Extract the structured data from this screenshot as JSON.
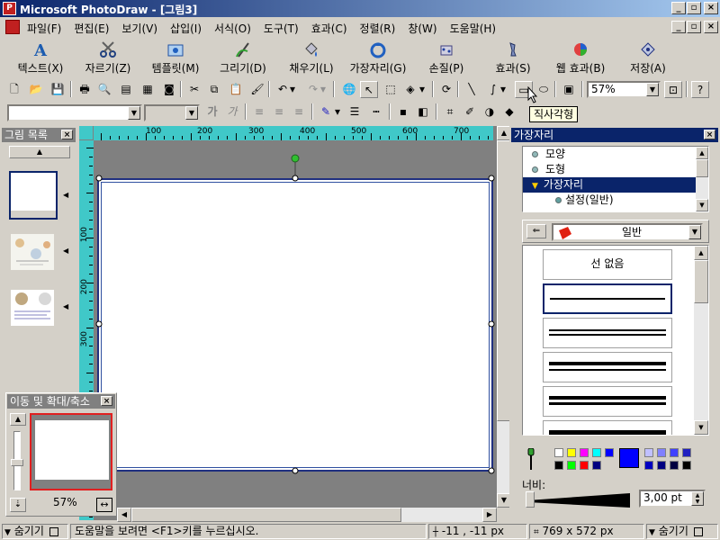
{
  "window": {
    "title": "Microsoft PhotoDraw - [그림3]"
  },
  "menu": [
    "파일(F)",
    "편집(E)",
    "보기(V)",
    "삽입(I)",
    "서식(O)",
    "도구(T)",
    "효과(C)",
    "정렬(R)",
    "창(W)",
    "도움말(H)"
  ],
  "big_toolbar": [
    {
      "label": "텍스트(X)",
      "icon": "text-icon"
    },
    {
      "label": "자르기(Z)",
      "icon": "scissors-icon"
    },
    {
      "label": "템플릿(M)",
      "icon": "template-icon"
    },
    {
      "label": "그리기(D)",
      "icon": "draw-icon"
    },
    {
      "label": "채우기(L)",
      "icon": "fill-icon"
    },
    {
      "label": "가장자리(G)",
      "icon": "edge-icon"
    },
    {
      "label": "손질(P)",
      "icon": "touchup-icon"
    },
    {
      "label": "효과(S)",
      "icon": "effects-icon"
    },
    {
      "label": "웹 효과(B)",
      "icon": "web-effects-icon"
    },
    {
      "label": "저장(A)",
      "icon": "save-icon"
    }
  ],
  "std_toolbar": {
    "zoom": "57%",
    "tooltip": "직사각형"
  },
  "format_toolbar": {
    "font": "",
    "size": "",
    "bold": "가",
    "italic": "가"
  },
  "picture_list": {
    "title": "그림 목록"
  },
  "pan_zoom": {
    "title": "이동 및 확대/축소",
    "zoom": "57%"
  },
  "ruler": {
    "h": [
      "100",
      "200",
      "300",
      "400",
      "500",
      "600",
      "700"
    ],
    "v": [
      "100",
      "200",
      "300"
    ]
  },
  "edge_panel": {
    "title": "가장자리",
    "tree": [
      {
        "label": "모양",
        "level": 0,
        "selected": false
      },
      {
        "label": "도형",
        "level": 0,
        "selected": false
      },
      {
        "label": "가장자리",
        "level": 0,
        "selected": true
      },
      {
        "label": "설정(일반)",
        "level": 1,
        "selected": false
      }
    ],
    "category": "일반",
    "styles": [
      {
        "label": "선 없음"
      }
    ],
    "width_label": "너비:",
    "width_value": "3,00 pt",
    "colors_top": [
      "#ffffff",
      "#ffff00",
      "#ff00ff",
      "#00ffff",
      "#0000ff"
    ],
    "colors_bottom": [
      "#000000",
      "#00ff00",
      "#ff0000",
      "#000080"
    ],
    "selected_color": "#0000ff",
    "colors_right_top": [
      "#c0c0ff",
      "#8080ff",
      "#4040ff",
      "#2020c0"
    ],
    "colors_right_bottom": [
      "#0000c0",
      "#000080",
      "#000040",
      "#000000"
    ]
  },
  "status": {
    "hide1": "숨기기",
    "help": "도움말을 보려면 <F1>키를 누르십시오.",
    "coords": "-11 , -11 px",
    "size": "769 x 572 px",
    "hide2": "숨기기"
  }
}
